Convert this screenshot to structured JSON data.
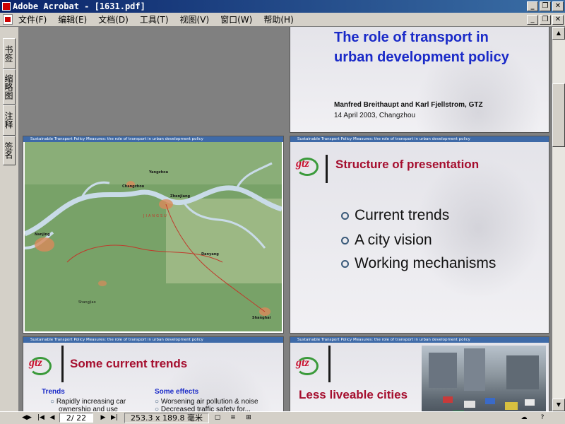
{
  "window": {
    "title": "Adobe Acrobat - [1631.pdf]",
    "buttons": [
      "_",
      "❐",
      "✕"
    ]
  },
  "menu": {
    "items": [
      "文件(F)",
      "编辑(E)",
      "文档(D)",
      "工具(T)",
      "视图(V)",
      "窗口(W)",
      "帮助(H)"
    ]
  },
  "left_tabs": [
    "书签",
    "缩略图",
    "注释",
    "签名"
  ],
  "slides": {
    "header_text": "Sustainable Transport Policy Measures: the role of transport in urban development policy",
    "s1": {
      "title_line1": "The role of transport in",
      "title_line2": "urban development policy",
      "authors": "Manfred Breithaupt and Karl Fjellstrom, GTZ",
      "date": "14 April 2003, Changzhou"
    },
    "s2": {
      "map_labels": [
        "Nanjing",
        "Zhenjiang",
        "Yangzhou",
        "Danyang",
        "Changzhou",
        "JIANGSU",
        "Shanghai",
        "Shangjiao"
      ]
    },
    "s3": {
      "logo": "gtz",
      "title": "Structure of presentation",
      "bullets": [
        "Current trends",
        "A city vision",
        "Working mechanisms"
      ]
    },
    "s4": {
      "logo": "gtz",
      "title": "Some current trends",
      "col1_head": "Trends",
      "col1_items": [
        "Rapidly increasing car",
        "ownership and use"
      ],
      "col2_head": "Some effects",
      "col2_items": [
        "Worsening air pollution & noise",
        "Decreased traffic safety for..."
      ]
    },
    "s5": {
      "logo": "gtz",
      "title": "Less liveable cities"
    }
  },
  "status": {
    "page": "2/ 22",
    "size": "253.3 x 189.8 毫米"
  },
  "colors": {
    "title_blue": "#1a2ac8",
    "title_red": "#a50e2e",
    "header_blue": "#3e6aa8",
    "logo_green": "#3a9a3a"
  }
}
